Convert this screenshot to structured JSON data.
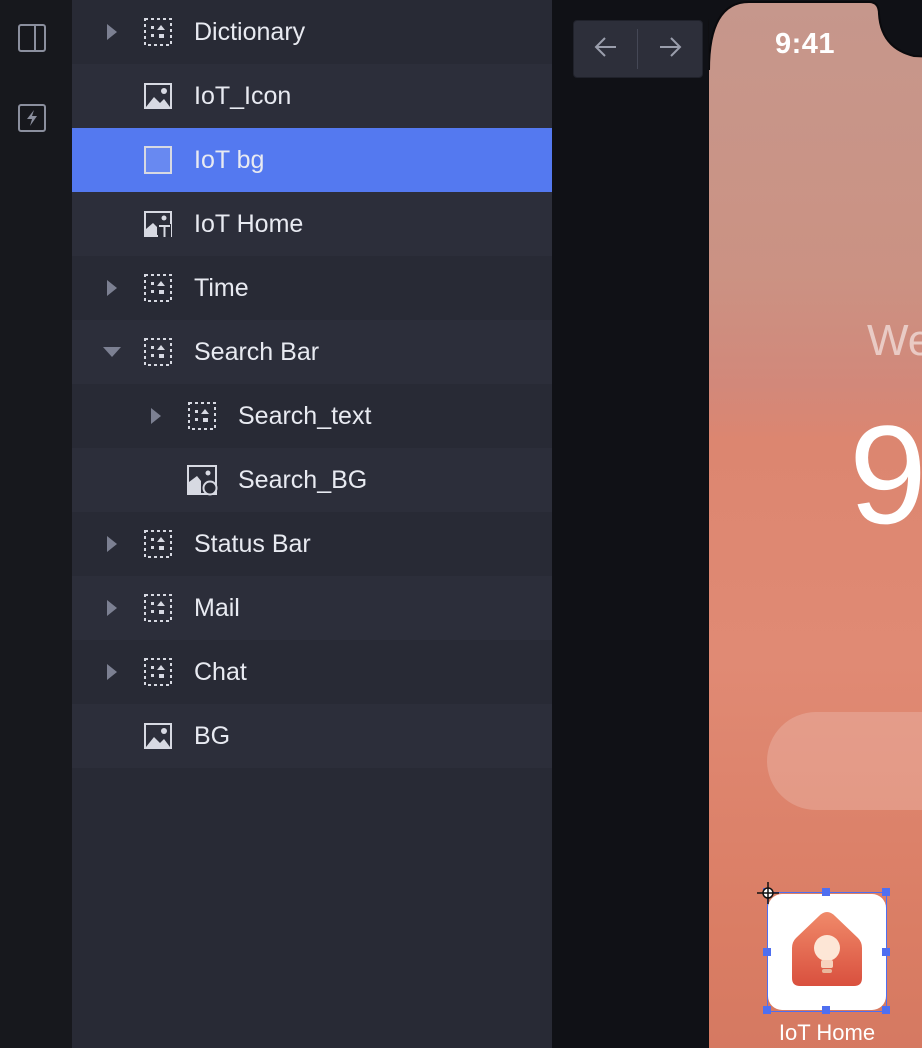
{
  "rail": {
    "items": [
      {
        "icon": "panel-toggle-icon"
      },
      {
        "icon": "lightning-icon"
      }
    ]
  },
  "layers": [
    {
      "label": "Dictionary",
      "icon": "group-icon",
      "caret": "right",
      "indent": 0,
      "selected": false
    },
    {
      "label": "IoT_Icon",
      "icon": "image-icon",
      "caret": "none",
      "indent": 0,
      "selected": false
    },
    {
      "label": "IoT bg",
      "icon": "rectangle-icon",
      "caret": "none",
      "indent": 0,
      "selected": true
    },
    {
      "label": "IoT Home",
      "icon": "image-text-icon",
      "caret": "none",
      "indent": 0,
      "selected": false
    },
    {
      "label": "Time",
      "icon": "group-icon",
      "caret": "right",
      "indent": 0,
      "selected": false
    },
    {
      "label": "Search Bar",
      "icon": "group-icon",
      "caret": "down",
      "indent": 0,
      "selected": false
    },
    {
      "label": "Search_text",
      "icon": "group-icon",
      "caret": "right",
      "indent": 1,
      "selected": false
    },
    {
      "label": "Search_BG",
      "icon": "shapes-icon",
      "caret": "none",
      "indent": 1,
      "selected": false
    },
    {
      "label": "Status Bar",
      "icon": "group-icon",
      "caret": "right",
      "indent": 0,
      "selected": false
    },
    {
      "label": "Mail",
      "icon": "group-icon",
      "caret": "right",
      "indent": 0,
      "selected": false
    },
    {
      "label": "Chat",
      "icon": "group-icon",
      "caret": "right",
      "indent": 0,
      "selected": false
    },
    {
      "label": "BG",
      "icon": "image-icon",
      "caret": "none",
      "indent": 0,
      "selected": false
    }
  ],
  "nav": {
    "back_icon": "arrow-left-icon",
    "forward_icon": "arrow-right-icon"
  },
  "device": {
    "status_time": "9:41",
    "welcome_text": "We",
    "big_number": "9",
    "app_label": "IoT Home",
    "app_icon": "lightbulb-house-icon"
  },
  "colors": {
    "selected_row": "#5479f0",
    "selection_handles": "#4f6ff0",
    "panel_bg": "#282a35"
  }
}
